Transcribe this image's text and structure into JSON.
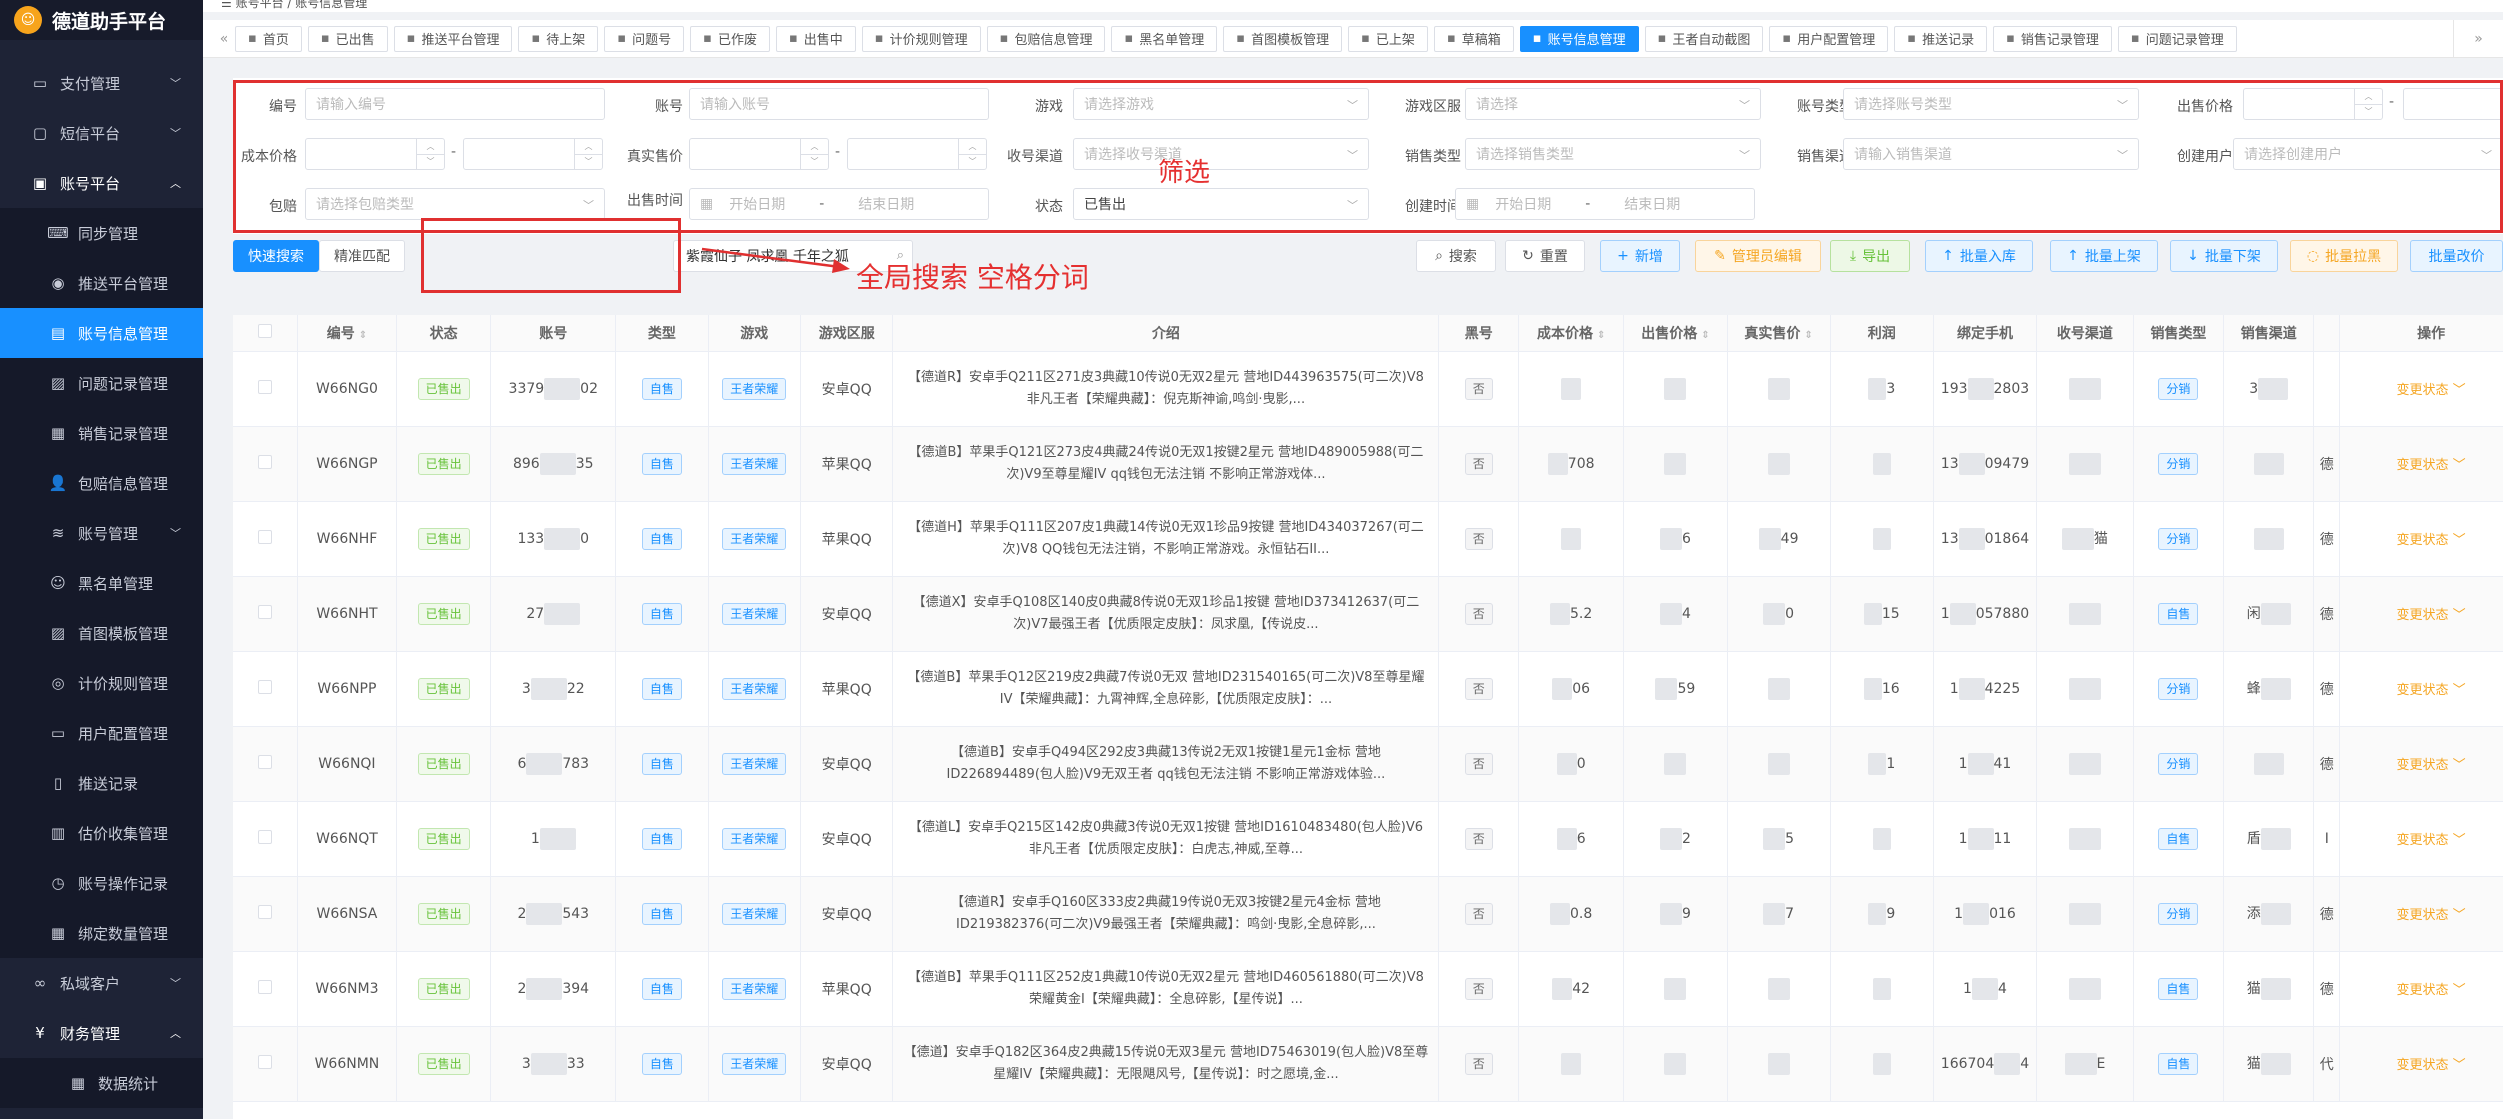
{
  "app": {
    "title": "德道助手平台",
    "breadcrumb_1": "账号平台",
    "breadcrumb_sep": "/",
    "breadcrumb_2": "账号信息管理"
  },
  "sidebar": {
    "top_items": [
      {
        "label": "支付管理",
        "icon": "payment-icon"
      },
      {
        "label": "短信平台",
        "icon": "message-icon"
      },
      {
        "label": "账号平台",
        "icon": "bag-icon"
      }
    ],
    "sub_items": [
      {
        "label": "同步管理",
        "icon": "keyboard-icon"
      },
      {
        "label": "推送平台管理",
        "icon": "eye-icon"
      },
      {
        "label": "账号信息管理",
        "icon": "document-icon"
      },
      {
        "label": "问题记录管理",
        "icon": "image-icon"
      },
      {
        "label": "销售记录管理",
        "icon": "cart-icon"
      },
      {
        "label": "包赔信息管理",
        "icon": "user-icon"
      },
      {
        "label": "账号管理",
        "icon": "layers-icon",
        "has_children": true
      },
      {
        "label": "黑名单管理",
        "icon": "smile-icon"
      },
      {
        "label": "首图模板管理",
        "icon": "image-icon"
      },
      {
        "label": "计价规则管理",
        "icon": "coin-icon"
      },
      {
        "label": "用户配置管理",
        "icon": "id-card-icon"
      },
      {
        "label": "推送记录",
        "icon": "clipboard-icon"
      },
      {
        "label": "估价收集管理",
        "icon": "calculator-icon"
      },
      {
        "label": "账号操作记录",
        "icon": "history-icon"
      },
      {
        "label": "绑定数量管理",
        "icon": "grid-icon"
      }
    ],
    "bottom_items": [
      {
        "label": "私域客户",
        "icon": "link-icon"
      },
      {
        "label": "财务管理",
        "icon": "yen-icon"
      }
    ],
    "finance_sub": [
      {
        "label": "数据统计",
        "icon": "chart-icon"
      }
    ]
  },
  "tabs": [
    {
      "label": "首页",
      "icon": "home-icon"
    },
    {
      "label": "已出售",
      "icon": "document-icon"
    },
    {
      "label": "推送平台管理",
      "icon": "eye-icon"
    },
    {
      "label": "待上架",
      "icon": "send-icon"
    },
    {
      "label": "问题号",
      "icon": "bulb-icon"
    },
    {
      "label": "已作废",
      "icon": "document-icon"
    },
    {
      "label": "出售中",
      "icon": "cart-icon"
    },
    {
      "label": "计价规则管理",
      "icon": "coin-icon"
    },
    {
      "label": "包赔信息管理",
      "icon": "user-icon"
    },
    {
      "label": "黑名单管理",
      "icon": "smile-icon"
    },
    {
      "label": "首图模板管理",
      "icon": "image-icon"
    },
    {
      "label": "已上架",
      "icon": "document-icon"
    },
    {
      "label": "草稿箱",
      "icon": "image-icon"
    },
    {
      "label": "账号信息管理",
      "icon": "document-icon",
      "active": true
    },
    {
      "label": "王者自动截图",
      "icon": "image-icon"
    },
    {
      "label": "用户配置管理",
      "icon": "id-card-icon"
    },
    {
      "label": "推送记录",
      "icon": "clipboard-icon"
    },
    {
      "label": "销售记录管理",
      "icon": "cart-icon"
    },
    {
      "label": "问题记录管理",
      "icon": "image-icon"
    }
  ],
  "filters": {
    "bianhao": {
      "label": "编号",
      "placeholder": "请输入编号"
    },
    "zhanghao": {
      "label": "账号",
      "placeholder": "请输入账号"
    },
    "youxi": {
      "label": "游戏",
      "placeholder": "请选择游戏"
    },
    "youxiquyu": {
      "label": "游戏区服",
      "placeholder": "请选择"
    },
    "zhanghaoleixing": {
      "label": "账号类型",
      "placeholder": "请选择账号类型"
    },
    "chushoujiage": {
      "label": "出售价格"
    },
    "chengbenjiage": {
      "label": "成本价格"
    },
    "zhenshishoujia": {
      "label": "真实售价"
    },
    "shouhaoqudao": {
      "label": "收号渠道",
      "placeholder": "请选择收号渠道"
    },
    "xiaoshouleixing": {
      "label": "销售类型",
      "placeholder": "请选择销售类型"
    },
    "xiaoshouqudao": {
      "label": "销售渠道",
      "placeholder": "请输入销售渠道"
    },
    "chuangjianyonghu": {
      "label": "创建用户",
      "placeholder": "请选择创建用户"
    },
    "baopei": {
      "label": "包赔",
      "placeholder": "请选择包赔类型"
    },
    "chushoushijian": {
      "label": "出售时间",
      "start": "开始日期",
      "end": "结束日期",
      "sep": "-"
    },
    "zhuangtai": {
      "label": "状态",
      "value": "已售出"
    },
    "chuangjianshijian": {
      "label": "创建时间",
      "start": "开始日期",
      "end": "结束日期",
      "sep": "-"
    },
    "range_sep": "-"
  },
  "annotations": {
    "filter_note": "筛选",
    "search_note": "全局搜索 空格分词"
  },
  "toolbar": {
    "quick_search": "快速搜索",
    "exact_match": "精准匹配",
    "search_value": "紫霞仙子 凤求凰 千年之狐",
    "search": "搜索",
    "reset": "重置",
    "add": "新增",
    "admin_edit": "管理员编辑",
    "export": "导出",
    "batch_import": "批量入库",
    "batch_up": "批量上架",
    "batch_down": "批量下架",
    "batch_pull": "批量拉黑",
    "batch_price": "批量改价"
  },
  "table": {
    "headers": [
      "编号",
      "状态",
      "账号",
      "类型",
      "游戏",
      "游戏区服",
      "介绍",
      "黑号",
      "成本价格",
      "出售价格",
      "真实售价",
      "利润",
      "绑定手机",
      "收号渠道",
      "销售类型",
      "销售渠道",
      "",
      "操作"
    ],
    "rows": [
      {
        "id": "W66NG0",
        "status": "已售出",
        "acc_a": "3379",
        "acc_b": "02",
        "type": "自售",
        "game": "王者荣耀",
        "server": "安卓QQ",
        "intro": "【德道R】安卓手Q211区271皮3典藏10传说0无双2星元 营地ID443963575(可二次)V8非凡王者【荣耀典藏】：倪克斯神谕,鸣剑·曳影,...",
        "black": "否",
        "cost": "",
        "sell": "",
        "real": "",
        "profit": "3",
        "phone_a": "193",
        "phone_b": "2803",
        "channel": "",
        "saletype": "分销",
        "salechan": "3",
        "extra": "",
        "op": "变更状态"
      },
      {
        "id": "W66NGP",
        "status": "已售出",
        "acc_a": "896",
        "acc_b": "35",
        "type": "自售",
        "game": "王者荣耀",
        "server": "苹果QQ",
        "intro": "【德道B】苹果手Q121区273皮4典藏24传说0无双1按键2星元 营地ID489005988(可二次)V9至尊星耀IV qq钱包无法注销 不影响正常游戏体...",
        "black": "否",
        "cost": "708",
        "sell": "",
        "real": "",
        "profit": "",
        "phone_a": "13",
        "phone_b": "09479",
        "channel": "",
        "saletype": "分销",
        "salechan": "",
        "extra": "德",
        "op": "变更状态"
      },
      {
        "id": "W66NHF",
        "status": "已售出",
        "acc_a": "133",
        "acc_b": "0",
        "type": "自售",
        "game": "王者荣耀",
        "server": "苹果QQ",
        "intro": "【德道H】苹果手Q111区207皮1典藏14传说0无双1珍品9按键 营地ID434037267(可二次)V8 QQ钱包无法注销，不影响正常游戏。永恒钻石II...",
        "black": "否",
        "cost": "",
        "sell": "6",
        "real": "49",
        "profit": "",
        "phone_a": "13",
        "phone_b": "01864",
        "channel": "猫",
        "saletype": "分销",
        "salechan": "",
        "extra": "德",
        "op": "变更状态"
      },
      {
        "id": "W66NHT",
        "status": "已售出",
        "acc_a": "27",
        "acc_b": "",
        "type": "自售",
        "game": "王者荣耀",
        "server": "安卓QQ",
        "intro": "【德道X】安卓手Q108区140皮0典藏8传说0无双1珍品1按键 营地ID373412637(可二次)V7最强王者【优质限定皮肤】：凤求凰,【传说皮...",
        "black": "否",
        "cost": "5.2",
        "sell": "4",
        "real": "0",
        "profit": "15",
        "phone_a": "1",
        "phone_b": "057880",
        "channel": "",
        "saletype": "自售",
        "salechan": "闲",
        "extra": "德",
        "op": "变更状态"
      },
      {
        "id": "W66NPP",
        "status": "已售出",
        "acc_a": "3",
        "acc_b": "22",
        "type": "自售",
        "game": "王者荣耀",
        "server": "苹果QQ",
        "intro": "【德道B】苹果手Q12区219皮2典藏7传说0无双 营地ID231540165(可二次)V8至尊星耀IV【荣耀典藏】：九霄神辉,全息碎影,【优质限定皮肤】：...",
        "black": "否",
        "cost": "06",
        "sell": "59",
        "real": "",
        "profit": "16",
        "phone_a": "1",
        "phone_b": "4225",
        "channel": "",
        "saletype": "分销",
        "salechan": "蜂",
        "extra": "德",
        "op": "变更状态"
      },
      {
        "id": "W66NQI",
        "status": "已售出",
        "acc_a": "6",
        "acc_b": "783",
        "type": "自售",
        "game": "王者荣耀",
        "server": "安卓QQ",
        "intro": "【德道B】安卓手Q494区292皮3典藏13传说2无双1按键1星元1金标 营地ID226894489(包人脸)V9无双王者 qq钱包无法注销 不影响正常游戏体验...",
        "black": "否",
        "cost": "0",
        "sell": "",
        "real": "",
        "profit": "1",
        "phone_a": "1",
        "phone_b": "41",
        "channel": "",
        "saletype": "分销",
        "salechan": "",
        "extra": "德",
        "op": "变更状态"
      },
      {
        "id": "W66NQT",
        "status": "已售出",
        "acc_a": "1",
        "acc_b": "",
        "type": "自售",
        "game": "王者荣耀",
        "server": "安卓QQ",
        "intro": "【德道L】安卓手Q215区142皮0典藏3传说0无双1按键 营地ID1610483480(包人脸)V6非凡王者【优质限定皮肤】：白虎志,神威,至尊...",
        "black": "否",
        "cost": "6",
        "sell": "2",
        "real": "5",
        "profit": "",
        "phone_a": "1",
        "phone_b": "11",
        "channel": "",
        "saletype": "自售",
        "salechan": "盾",
        "extra": "I",
        "op": "变更状态"
      },
      {
        "id": "W66NSA",
        "status": "已售出",
        "acc_a": "2",
        "acc_b": "543",
        "type": "自售",
        "game": "王者荣耀",
        "server": "安卓QQ",
        "intro": "【德道R】安卓手Q160区333皮2典藏19传说0无双3按键2星元4金标 营地ID219382376(可二次)V9最强王者【荣耀典藏】：鸣剑·曳影,全息碎影,...",
        "black": "否",
        "cost": "0.8",
        "sell": "9",
        "real": "7",
        "profit": "9",
        "phone_a": "1",
        "phone_b": "016",
        "channel": "",
        "saletype": "分销",
        "salechan": "添",
        "extra": "德",
        "op": "变更状态"
      },
      {
        "id": "W66NM3",
        "status": "已售出",
        "acc_a": "2",
        "acc_b": "394",
        "type": "自售",
        "game": "王者荣耀",
        "server": "苹果QQ",
        "intro": "【德道B】苹果手Q111区252皮1典藏10传说0无双2星元 营地ID460561880(可二次)V8荣耀黄金I【荣耀典藏】：全息碎影,【星传说】...",
        "black": "否",
        "cost": "42",
        "sell": "",
        "real": "",
        "profit": "",
        "phone_a": "1",
        "phone_b": "4",
        "channel": "",
        "saletype": "自售",
        "salechan": "猫",
        "extra": "德",
        "op": "变更状态"
      },
      {
        "id": "W66NMN",
        "status": "已售出",
        "acc_a": "3",
        "acc_b": "33",
        "type": "自售",
        "game": "王者荣耀",
        "server": "安卓QQ",
        "intro": "【德道】安卓手Q182区364皮2典藏15传说0无双3星元 营地ID75463019(包人脸)V8至尊星耀IV【荣耀典藏】：无限飓风号,【星传说】：时之愿境,金...",
        "black": "否",
        "cost": "",
        "sell": "",
        "real": "",
        "profit": "",
        "phone_a": "166704",
        "phone_b": "4",
        "channel": "E",
        "saletype": "自售",
        "salechan": "猫",
        "extra": "代",
        "op": "变更状态"
      }
    ]
  },
  "colors": {
    "primary": "#1890ff",
    "sidebar": "#1e2336",
    "annotation": "#e03030"
  }
}
